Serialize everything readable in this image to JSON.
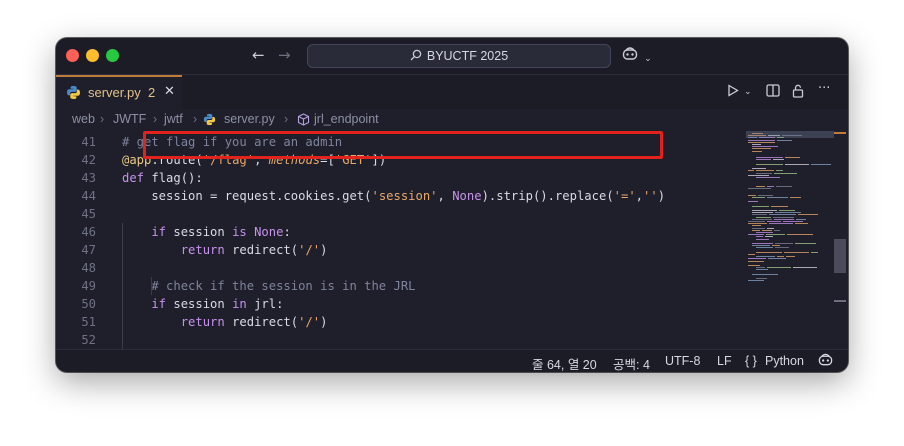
{
  "window": {
    "search_text": "BYUCTF 2025"
  },
  "tab": {
    "filename": "server.py",
    "problem_count": "2"
  },
  "breadcrumbs": [
    "web",
    "JWTF",
    "jwtf",
    "server.py",
    "jrl_endpoint"
  ],
  "code_lines": [
    {
      "num": "41",
      "segments": [
        {
          "t": "# get flag if you are an admin",
          "c": "cmt"
        }
      ]
    },
    {
      "num": "42",
      "segments": [
        {
          "t": "@app",
          "c": "dec"
        },
        {
          "t": ".route(",
          "c": "fn"
        },
        {
          "t": "'/flag'",
          "c": "str"
        },
        {
          "t": ", ",
          "c": "fn"
        },
        {
          "t": "methods",
          "c": "param"
        },
        {
          "t": "=[",
          "c": "fn"
        },
        {
          "t": "'GET'",
          "c": "str"
        },
        {
          "t": "])",
          "c": "fn"
        }
      ]
    },
    {
      "num": "43",
      "segments": [
        {
          "t": "def ",
          "c": "kw"
        },
        {
          "t": "flag():",
          "c": "fn"
        }
      ]
    },
    {
      "num": "44",
      "segments": [
        {
          "t": "    session = request.cookies.get(",
          "c": "fn"
        },
        {
          "t": "'session'",
          "c": "str"
        },
        {
          "t": ", ",
          "c": "fn"
        },
        {
          "t": "None",
          "c": "kw"
        },
        {
          "t": ").strip().replace(",
          "c": "fn"
        },
        {
          "t": "'='",
          "c": "str"
        },
        {
          "t": ",",
          "c": "fn"
        },
        {
          "t": "''",
          "c": "str"
        },
        {
          "t": ")",
          "c": "fn"
        }
      ]
    },
    {
      "num": "45",
      "segments": []
    },
    {
      "num": "46",
      "segments": [
        {
          "t": "    if ",
          "c": "kw"
        },
        {
          "t": "session ",
          "c": "fn"
        },
        {
          "t": "is ",
          "c": "kw"
        },
        {
          "t": "None",
          "c": "kw"
        },
        {
          "t": ":",
          "c": "fn"
        }
      ]
    },
    {
      "num": "47",
      "segments": [
        {
          "t": "        return ",
          "c": "kw"
        },
        {
          "t": "redirect(",
          "c": "fn"
        },
        {
          "t": "'/'",
          "c": "str"
        },
        {
          "t": ")",
          "c": "fn"
        }
      ]
    },
    {
      "num": "48",
      "segments": []
    },
    {
      "num": "49",
      "segments": [
        {
          "t": "    # check if the session is in the JRL",
          "c": "cmt"
        }
      ]
    },
    {
      "num": "50",
      "segments": [
        {
          "t": "    if ",
          "c": "kw"
        },
        {
          "t": "session ",
          "c": "fn"
        },
        {
          "t": "in ",
          "c": "kw"
        },
        {
          "t": "jrl:",
          "c": "fn"
        }
      ]
    },
    {
      "num": "51",
      "segments": [
        {
          "t": "        return ",
          "c": "kw"
        },
        {
          "t": "redirect(",
          "c": "fn"
        },
        {
          "t": "'/'",
          "c": "str"
        },
        {
          "t": ")",
          "c": "fn"
        }
      ]
    },
    {
      "num": "52",
      "segments": []
    }
  ],
  "status": {
    "cursor": "줄 64, 열 20",
    "indent": "공백: 4",
    "encoding": "UTF-8",
    "eol": "LF",
    "language": "Python"
  },
  "colors": {
    "highlight_box": "#e0231c",
    "tab_accent": "#c07a3a",
    "window_bg": "#1e1f2b"
  }
}
